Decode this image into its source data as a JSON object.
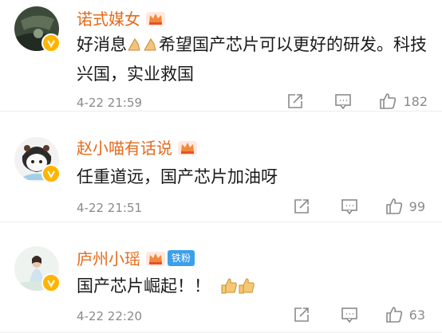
{
  "comments": [
    {
      "username": "诺式媒女",
      "text_before": "好消息",
      "text_after": "希望国产芯片可以更好的研发。科技兴国，实业救国",
      "time": "4-22 21:59",
      "likes": "182",
      "fan_badge": ""
    },
    {
      "username": "赵小喵有话说",
      "text_before": "任重道远，国产芯片加油呀",
      "text_after": "",
      "time": "4-22 21:51",
      "likes": "99",
      "fan_badge": ""
    },
    {
      "username": "庐州小瑶",
      "text_before": "国产芯片崛起！！",
      "text_after": "",
      "time": "4-22 22:20",
      "likes": "63",
      "fan_badge": "铁粉"
    }
  ],
  "icons": {
    "share": "share-icon",
    "comment": "comment-icon",
    "like": "thumbs-up-icon",
    "verified": "verified-badge-icon",
    "crown": "vip-crown-icon",
    "pray": "pray-emoji",
    "thumbs": "thumbs-up-emoji"
  },
  "colors": {
    "username": "#e56a1b",
    "fan_badge": "#3aa0ea",
    "verified": "#ffb400",
    "meta": "#8a8a8a"
  }
}
